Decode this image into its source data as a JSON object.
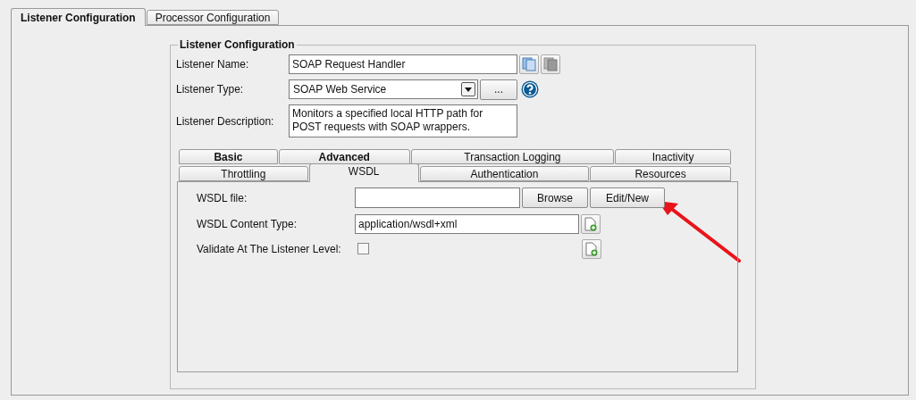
{
  "top_tabs": [
    {
      "label": "Listener Configuration",
      "selected": true
    },
    {
      "label": "Processor Configuration",
      "selected": false
    }
  ],
  "listener": {
    "legend": "Listener Configuration",
    "name_label": "Listener Name:",
    "name": "SOAP Request Handler",
    "type_label": "Listener Type:",
    "type": "SOAP Web Service",
    "type_button": "...",
    "description_label": "Listener Description:",
    "description": "Monitors a specified local HTTP path for\nPOST requests with SOAP wrappers."
  },
  "tab_rows": [
    [
      {
        "label": "Basic",
        "selected": false,
        "emphasized": true
      },
      {
        "label": "Advanced",
        "selected": false,
        "emphasized": true
      },
      {
        "label": "Transaction Logging",
        "selected": false,
        "emphasized": false
      },
      {
        "label": "Inactivity",
        "selected": false,
        "emphasized": false
      }
    ],
    [
      {
        "label": "Throttling",
        "selected": false,
        "emphasized": false
      },
      {
        "label": "WSDL",
        "selected": true,
        "emphasized": false
      },
      {
        "label": "Authentication",
        "selected": false,
        "emphasized": false
      },
      {
        "label": "Resources",
        "selected": false,
        "emphasized": false
      }
    ]
  ],
  "wsdl": {
    "file_label": "WSDL file:",
    "browse": "Browse",
    "edit": "Edit/New",
    "content_type_label": "WSDL Content Type:",
    "content_type": "application/wsdl+xml",
    "validate_label": "Validate At The Listener Level:",
    "validate_checked": false
  }
}
